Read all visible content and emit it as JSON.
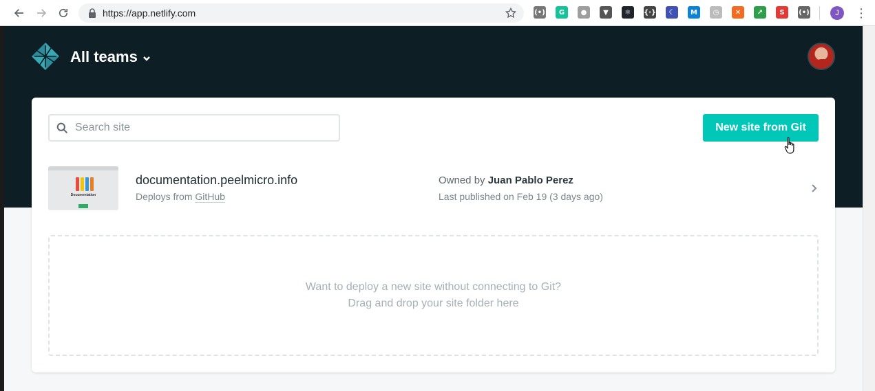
{
  "browser": {
    "url": "https://app.netlify.com",
    "profile_initial": "J",
    "extensions": [
      {
        "name": "lighthouse-icon",
        "glyph": "((•))",
        "color": "#777777"
      },
      {
        "name": "grammarly-icon",
        "glyph": "G",
        "color": "#15c39a"
      },
      {
        "name": "circle-ext-icon",
        "glyph": "●",
        "color": "#9e9e9e"
      },
      {
        "name": "vue-devtools-icon",
        "glyph": "▼",
        "color": "#555555"
      },
      {
        "name": "react-devtools-icon",
        "glyph": "⚛",
        "color": "#20232a"
      },
      {
        "name": "code-ext-icon",
        "glyph": "{·}",
        "color": "#444444"
      },
      {
        "name": "moon-ext-icon",
        "glyph": "☾",
        "color": "#3f51b5"
      },
      {
        "name": "movistar-ext-icon",
        "glyph": "M",
        "color": "#0b82d6"
      },
      {
        "name": "timer-ext-icon",
        "glyph": "◷",
        "color": "#bbbbbb"
      },
      {
        "name": "orange-ext-icon",
        "glyph": "✕",
        "color": "#f26b21"
      },
      {
        "name": "green-arrow-ext-icon",
        "glyph": "↗",
        "color": "#2e9e4a"
      },
      {
        "name": "red-ext-icon",
        "glyph": "S",
        "color": "#e53935"
      },
      {
        "name": "broadcast-ext-icon",
        "glyph": "(•)",
        "color": "#666666"
      }
    ]
  },
  "header": {
    "team_label": "All teams"
  },
  "search": {
    "placeholder": "Search site"
  },
  "actions": {
    "new_site_label": "New site from Git"
  },
  "sites": [
    {
      "name": "documentation.peelmicro.info",
      "deploys_prefix": "Deploys from ",
      "deploys_source": "GitHub",
      "owned_prefix": "Owned by ",
      "owner": "Juan Pablo Perez",
      "published": "Last published on Feb 19 (3 days ago)",
      "thumbnail_title": "Documentation"
    }
  ],
  "dropzone": {
    "line1": "Want to deploy a new site without connecting to Git?",
    "line2": "Drag and drop your site folder here"
  },
  "colors": {
    "header_bg": "#0e1e25",
    "accent": "#00c7b7"
  }
}
